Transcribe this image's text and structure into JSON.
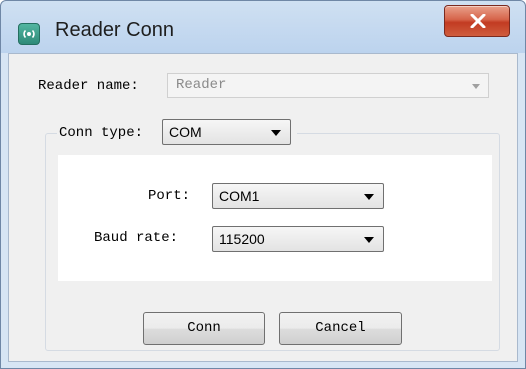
{
  "window": {
    "title": "Reader Conn",
    "icon": "radio-signal-icon",
    "close_icon": "close-icon"
  },
  "form": {
    "reader_name_label": "Reader name:",
    "reader_name_value": "Reader",
    "conn_type_label": "Conn type:",
    "conn_type_value": "COM",
    "port_label": "Port:",
    "port_value": "COM1",
    "baud_rate_label": "Baud rate:",
    "baud_rate_value": "115200"
  },
  "buttons": {
    "conn": "Conn",
    "cancel": "Cancel"
  },
  "colors": {
    "close_button": "#c23b22",
    "title_bar": "#bcd3ee",
    "client_background": "#f0f0f0"
  }
}
